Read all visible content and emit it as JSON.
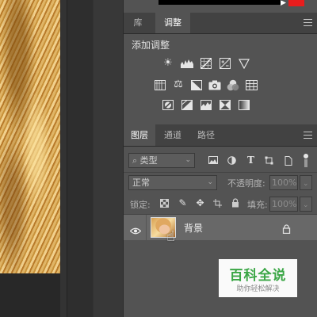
{
  "adjust_tabs": {
    "library": "库",
    "adjustments": "调整"
  },
  "adjustments": {
    "title": "添加调整",
    "row1": [
      "brightness-icon",
      "levels-icon",
      "curves-icon",
      "exposure-icon",
      "gradient-triangle-icon"
    ],
    "row2": [
      "vibrance-icon",
      "color-balance-icon",
      "black-white-icon",
      "photo-filter-icon",
      "channel-mixer-icon",
      "color-lookup-icon"
    ],
    "row3": [
      "invert-icon",
      "posterize-icon",
      "threshold-icon",
      "selective-color-icon",
      "gradient-map-icon"
    ]
  },
  "layer_tabs": {
    "layers": "图层",
    "channels": "通道",
    "paths": "路径"
  },
  "layers": {
    "filter_kind_label": "类型",
    "blend_mode": "正常",
    "opacity_label": "不透明度:",
    "opacity_value": "100%",
    "lock_label": "锁定:",
    "fill_label": "填充:",
    "fill_value": "100%",
    "items": [
      {
        "name": "背景",
        "visible": true,
        "locked": true
      }
    ]
  },
  "watermark": {
    "title": "百科全说",
    "subtitle": "助你轻松解决"
  },
  "colors": {
    "accent_red": "#e81d1d",
    "watermark_green": "#3aa645"
  }
}
